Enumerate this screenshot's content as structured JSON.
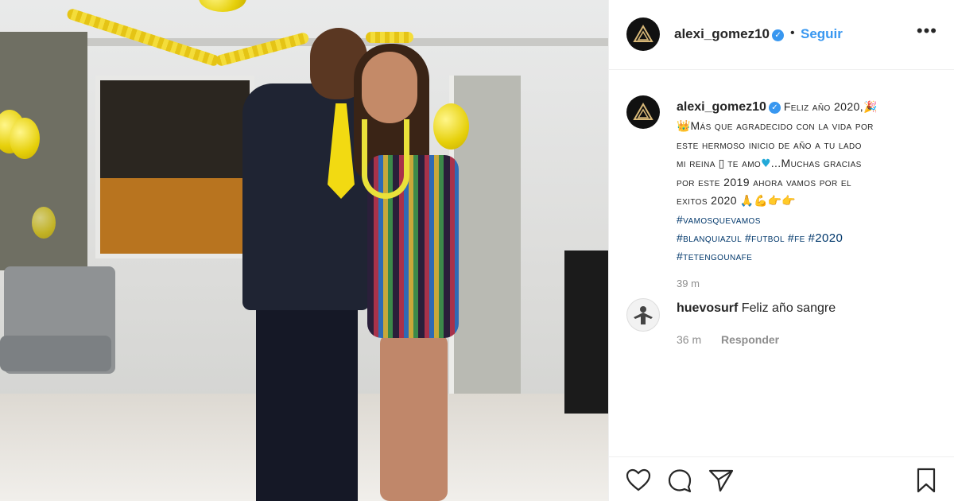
{
  "post": {
    "username": "alexi_gomez10",
    "separator": "•",
    "follow_label": "Seguir",
    "more_label": "•••"
  },
  "caption": {
    "author": "alexi_gomez10",
    "line1": "Feliz año 2020,",
    "line2": "Más que agradecido con la vida por",
    "line3": "este hermoso inicio de año a tu lado",
    "line4a": "mi reina",
    "line4b": "te amo",
    "line4c": "...Muchas gracias",
    "line5": "por este 2019 ahora vamos por el",
    "line6": "exitos 2020",
    "hashtag1": "#vamosquevamos",
    "hashtag2": "#blanquiazul",
    "hashtag3": "#futbol",
    "hashtag4": "#fe",
    "hashtag5": "#2020",
    "hashtag6": "#tetengounafe",
    "time": "39 m"
  },
  "comments": [
    {
      "author": "huevosurf",
      "text": "Feliz año sangre",
      "time": "36 m",
      "reply_label": "Responder"
    }
  ],
  "icons": {
    "verified": "verified-badge-icon",
    "like": "heart-icon",
    "comment": "comment-icon",
    "share": "share-icon",
    "save": "bookmark-icon"
  },
  "colors": {
    "link_blue": "#3897f0",
    "hashtag": "#00376b",
    "muted": "#8e8e8e"
  }
}
